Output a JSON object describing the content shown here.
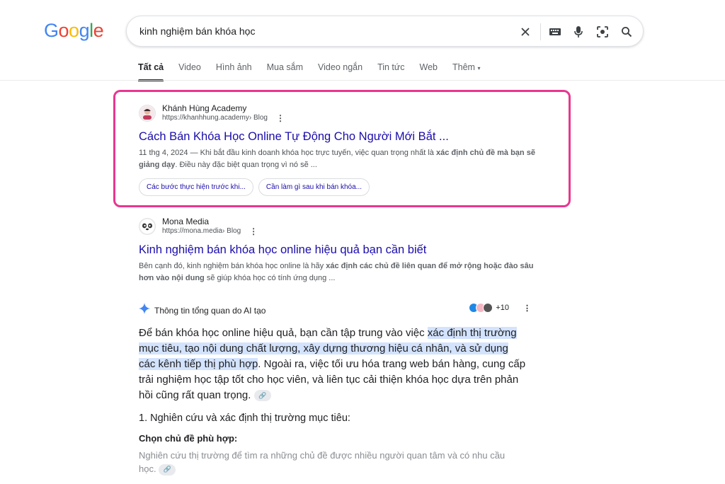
{
  "logo": {
    "letters": [
      "G",
      "o",
      "o",
      "g",
      "l",
      "e"
    ],
    "colors": [
      "#4285f4",
      "#ea4335",
      "#fbbc05",
      "#4285f4",
      "#34a853",
      "#ea4335"
    ]
  },
  "search": {
    "query": "kinh nghiệm bán khóa học"
  },
  "tabs": [
    "Tất cả",
    "Video",
    "Hình ảnh",
    "Mua sắm",
    "Video ngắn",
    "Tin tức",
    "Web",
    "Thêm"
  ],
  "results": [
    {
      "site_name": "Khánh Hùng Academy",
      "url": "https://khanhhung.academy",
      "url_path": " › Blog",
      "title": "Cách Bán Khóa Học Online Tự Động Cho Người Mới Bắt ...",
      "snippet_plain": "11 thg 4, 2024 — Khi bắt đầu kinh doanh khóa học trực tuyến, việc quan trọng nhất là ",
      "snippet_bold": "xác định chủ đề mà bạn sẽ giảng dạy",
      "snippet_end": ". Điều này đặc biệt quan trọng vì nó sẽ ...",
      "chips": [
        "Các bước thực hiện trước khi...",
        "Cần làm gì sau khi bán khóa..."
      ]
    },
    {
      "site_name": "Mona Media",
      "url": "https://mona.media",
      "url_path": " › Blog",
      "title": "Kinh nghiệm bán khóa học online hiệu quả bạn cần biết",
      "snippet_plain": "Bên cạnh đó, kinh nghiệm bán khóa học online là hãy ",
      "snippet_bold": "xác định các chủ đề liên quan để mở rộng hoặc đào sâu hơn vào nội dung",
      "snippet_end": " sẽ giúp khóa học có tính ứng dụng ..."
    }
  ],
  "ai_overview": {
    "title": "Thông tin tổng quan do AI tạo",
    "sources_count": "+10",
    "p1_start": "Để bán khóa học online hiệu quả, bạn cần tập trung vào việc ",
    "p1_highlight": "xác định thị trường mục tiêu, tạo nội dung chất lượng, xây dựng thương hiệu cá nhân, và sử dụng các kênh tiếp thị phù hợp",
    "p1_end": ". Ngoài ra, việc tối ưu hóa trang web bán hàng, cung cấp trải nghiệm học tập tốt cho học viên, và liên tục cải thiện khóa học dựa trên phản hồi cũng rất quan trọng.",
    "heading1": "1. Nghiên cứu và xác định thị trường mục tiêu:",
    "heading2": "Chọn chủ đề phù hợp:",
    "faded_text": "Nghiên cứu thị trường để tìm ra những chủ đề được nhiều người quan tâm và có nhu cầu học."
  },
  "colors": {
    "highlight_frame": "#e8368f",
    "link": "#1a0dab",
    "ai_highlight": "#d3e3fd"
  }
}
